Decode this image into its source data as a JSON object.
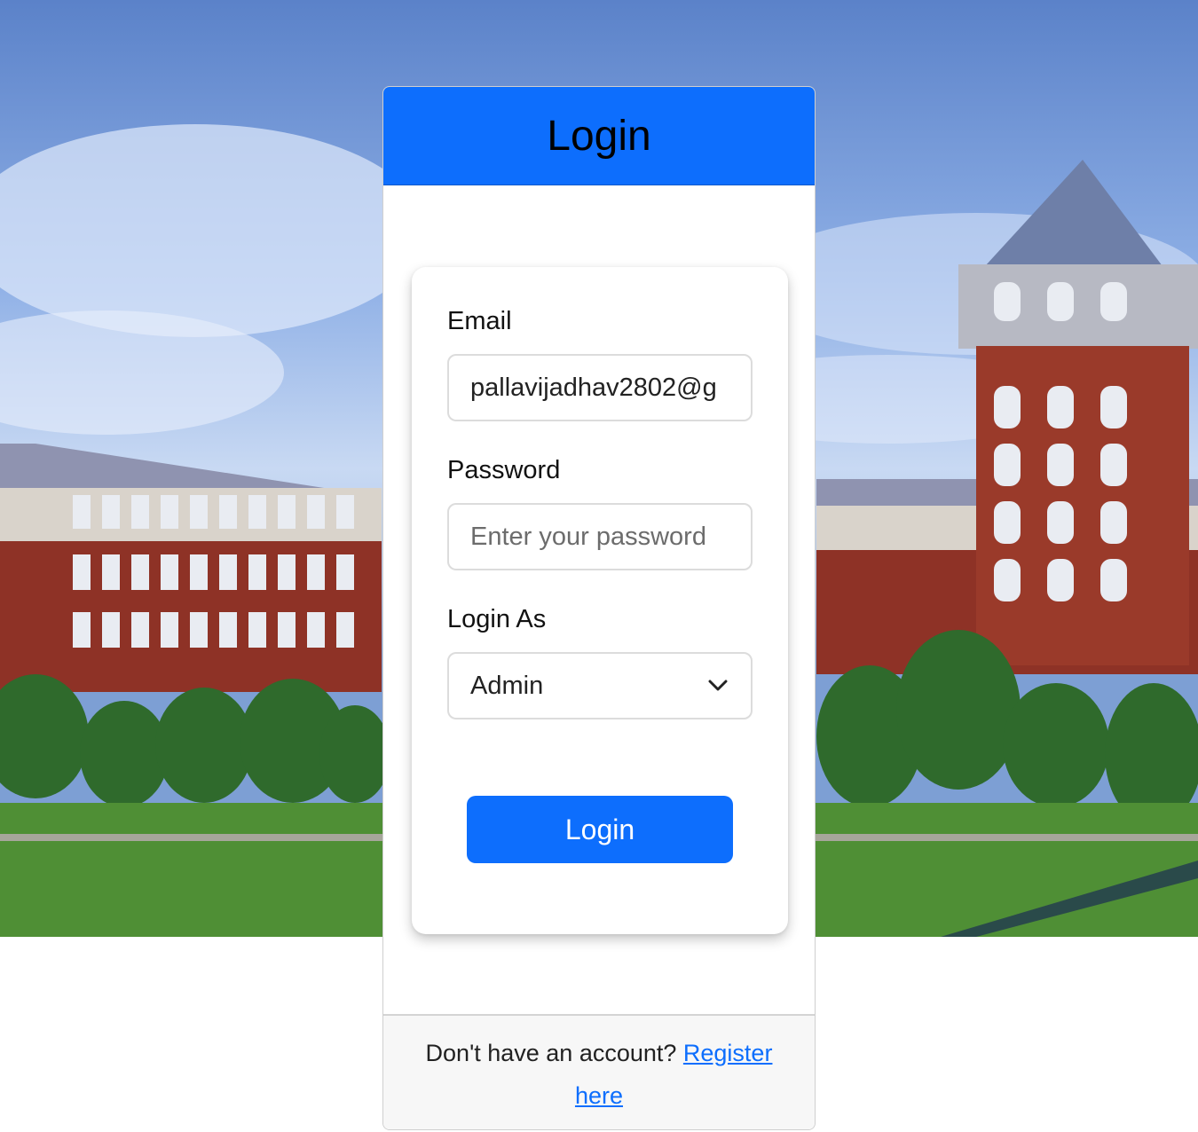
{
  "header": {
    "title": "Login"
  },
  "form": {
    "email_label": "Email",
    "email_value": "pallavijadhav2802@g",
    "password_label": "Password",
    "password_placeholder": "Enter your password",
    "password_value": "",
    "role_label": "Login As",
    "role_selected": "Admin",
    "submit_label": "Login"
  },
  "footer": {
    "prompt": "Don't have an account? ",
    "register_link": "Register here"
  },
  "colors": {
    "primary": "#0d6efd",
    "footer_bg": "#f7f7f7"
  },
  "icons": {
    "select_chevron": "chevron-down-icon"
  }
}
